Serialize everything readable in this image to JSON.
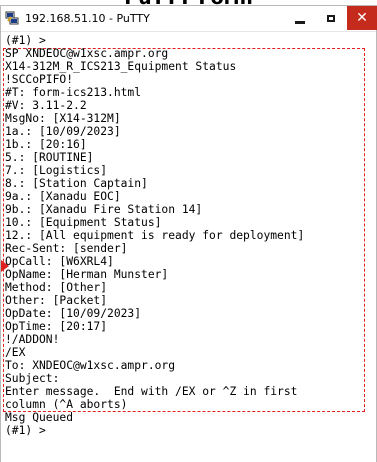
{
  "window": {
    "title": "192.168.51.10 - PuTTY",
    "heading": "PuTTY Form"
  },
  "terminal": {
    "lines": [
      "(#1) >",
      "SP XNDEOC@w1xsc.ampr.org",
      "X14-312M_R_ICS213_Equipment Status",
      "!SCCoPIFO!",
      "#T: form-ics213.html",
      "#V: 3.11-2.2",
      "MsgNo: [X14-312M]",
      "1a.: [10/09/2023]",
      "1b.: [20:16]",
      "5.: [ROUTINE]",
      "7.: [Logistics]",
      "8.: [Station Captain]",
      "9a.: [Xanadu EOC]",
      "9b.: [Xanadu Fire Station 14]",
      "10.: [Equipment Status]",
      "12.: [All equipment is ready for deployment]",
      "Rec-Sent: [sender]",
      "OpCall: [W6XRL4]",
      "OpName: [Herman Munster]",
      "Method: [Other]",
      "Other: [Packet]",
      "OpDate: [10/09/2023]",
      "OpTime: [20:17]",
      "!/ADDON!",
      "/EX",
      "To: XNDEOC@w1xsc.ampr.org",
      "Subject:",
      "Enter message.  End with /EX or ^Z in first",
      "column (^A aborts)",
      "Msg Queued",
      "(#1) >"
    ]
  },
  "colors": {
    "highlight": "#e02020",
    "close_button": "#c42b1c"
  },
  "icons": {
    "app": "putty-icon",
    "minimize": "minimize-icon",
    "maximize": "maximize-icon",
    "close": "close-icon"
  }
}
